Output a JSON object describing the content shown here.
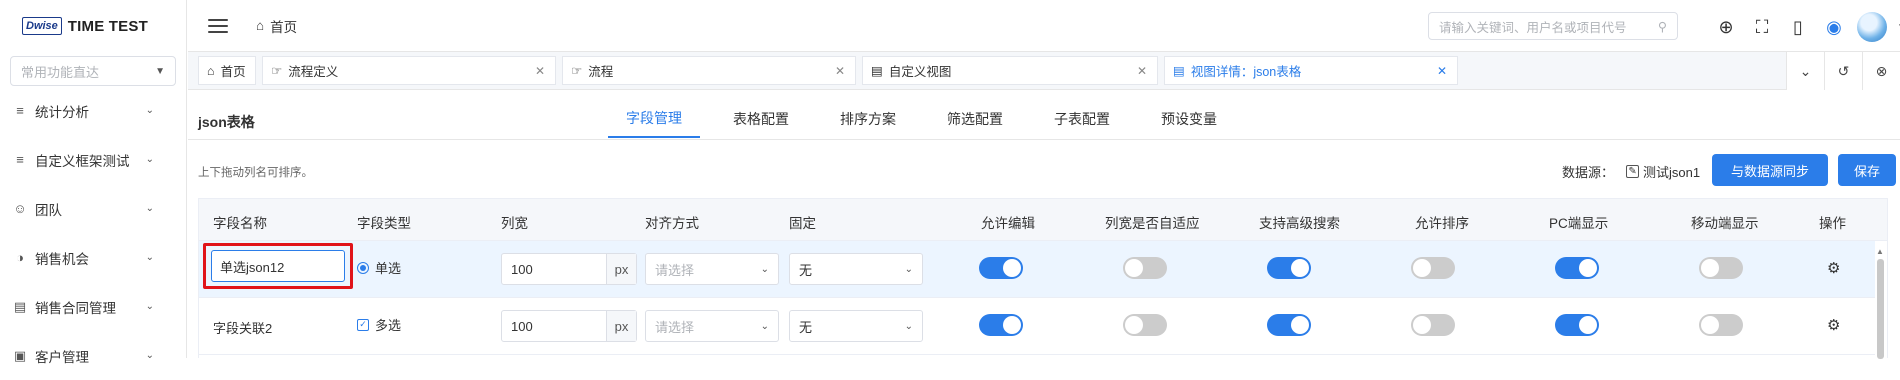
{
  "app": {
    "logo_mark": "Dwise",
    "title": "TIME TEST"
  },
  "sidebar": {
    "search_placeholder": "常用功能直达",
    "items": [
      {
        "label": "统计分析",
        "icon": "list-icon"
      },
      {
        "label": "自定义框架测试",
        "icon": "list-icon"
      },
      {
        "label": "团队",
        "icon": "team-icon"
      },
      {
        "label": "销售机会",
        "icon": "pie-chart-icon"
      },
      {
        "label": "销售合同管理",
        "icon": "document-icon"
      },
      {
        "label": "客户管理",
        "icon": "customer-icon"
      }
    ]
  },
  "header": {
    "breadcrumb": "首页",
    "search_placeholder": "请输入关键词、用户名或项目代号"
  },
  "page_tabs": [
    {
      "label": "首页",
      "icon": "home-icon",
      "closable": false,
      "active": false
    },
    {
      "label": "流程定义",
      "icon": "thumbs-up-icon",
      "closable": true,
      "active": false
    },
    {
      "label": "流程",
      "icon": "thumbs-up-icon",
      "closable": true,
      "active": false
    },
    {
      "label": "自定义视图",
      "icon": "document-icon",
      "closable": true,
      "active": false
    },
    {
      "label": "视图详情：json表格",
      "icon": "document-icon",
      "closable": true,
      "active": true
    }
  ],
  "content": {
    "title": "json表格",
    "sub_tabs": [
      "字段管理",
      "表格配置",
      "排序方案",
      "筛选配置",
      "子表配置",
      "预设变量"
    ],
    "active_sub_tab": "字段管理",
    "hint": "上下拖动列名可排序。",
    "datasource_label": "数据源：",
    "datasource_value": "测试json1",
    "sync_button": "与数据源同步",
    "save_button": "保存"
  },
  "table": {
    "headers": [
      "字段名称",
      "字段类型",
      "列宽",
      "对齐方式",
      "固定",
      "允许编辑",
      "列宽是否自适应",
      "支持高级搜索",
      "允许排序",
      "PC端显示",
      "移动端显示",
      "操作"
    ],
    "rows": [
      {
        "name": "单选json12",
        "type": "单选",
        "width": "100",
        "unit": "px",
        "align_placeholder": "请选择",
        "fixed": "无",
        "allow_edit": true,
        "auto_width": false,
        "advanced_search": true,
        "allow_sort": false,
        "pc_show": true,
        "mobile_show": false
      },
      {
        "name": "字段关联2",
        "type": "多选",
        "width": "100",
        "unit": "px",
        "align_placeholder": "请选择",
        "fixed": "无",
        "allow_edit": true,
        "auto_width": false,
        "advanced_search": true,
        "allow_sort": false,
        "pc_show": true,
        "mobile_show": false
      }
    ]
  },
  "colors": {
    "primary": "#2b7de9",
    "highlight": "#e0131a",
    "selected_row": "#ecf5ff"
  }
}
